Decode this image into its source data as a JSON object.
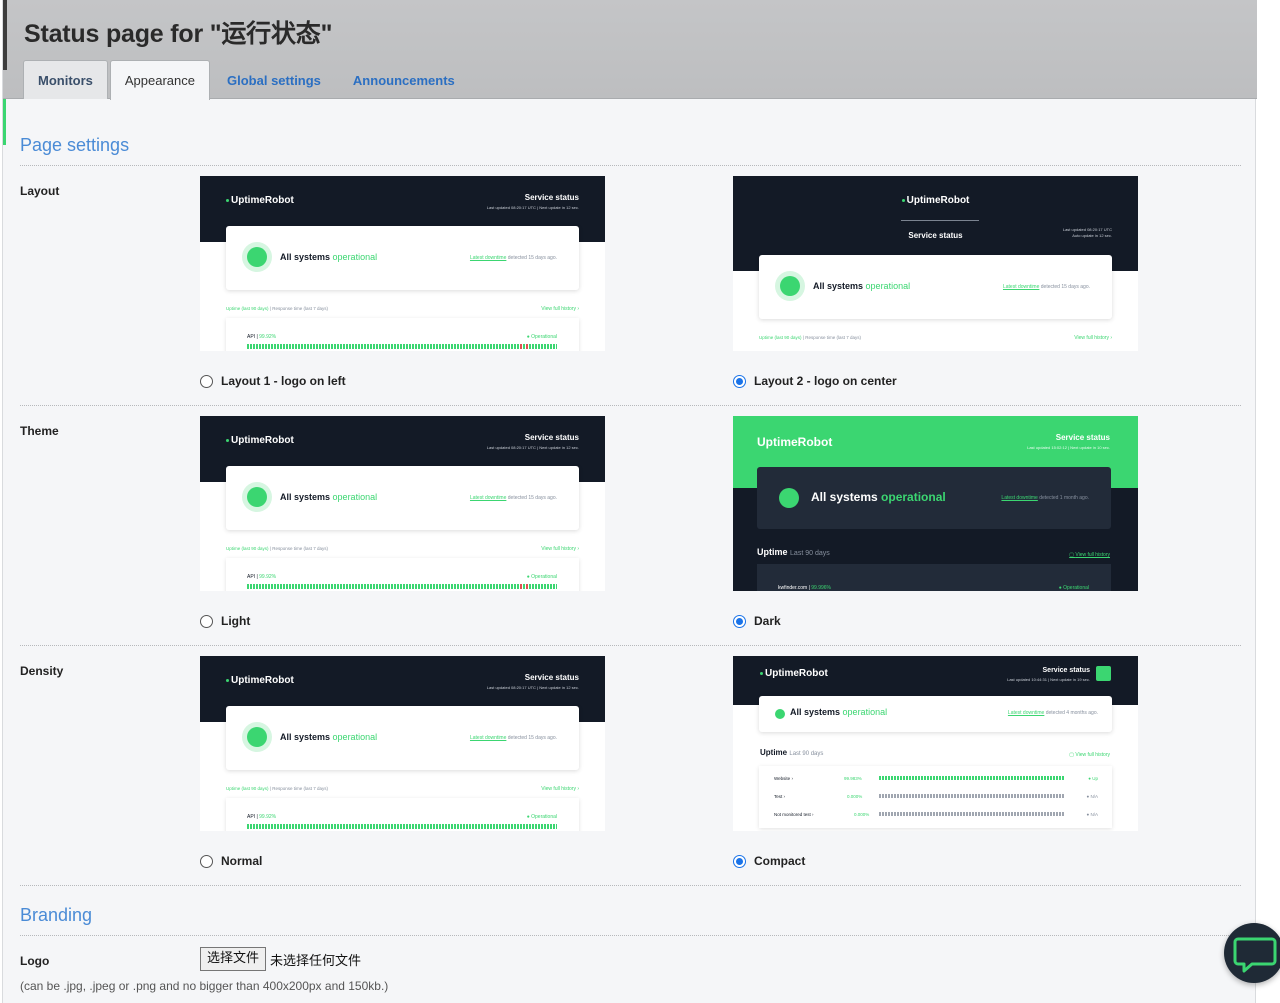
{
  "header": {
    "title": "Status page for \"运行状态\"",
    "tabs": [
      {
        "label": "Monitors"
      },
      {
        "label": "Appearance"
      },
      {
        "label": "Global settings"
      },
      {
        "label": "Announcements"
      }
    ]
  },
  "page_settings": {
    "title": "Page settings",
    "layout": {
      "label": "Layout",
      "options": [
        {
          "label": "Layout 1 - logo on left",
          "selected": false
        },
        {
          "label": "Layout 2 - logo on center",
          "selected": true
        }
      ]
    },
    "theme": {
      "label": "Theme",
      "options": [
        {
          "label": "Light",
          "selected": false
        },
        {
          "label": "Dark",
          "selected": true
        }
      ]
    },
    "density": {
      "label": "Density",
      "options": [
        {
          "label": "Normal",
          "selected": false
        },
        {
          "label": "Compact",
          "selected": true
        }
      ]
    }
  },
  "preview": {
    "brand": "UptimeRobot",
    "service_status": "Service status",
    "last_updated": "Last updated  08:20:17 UTC | Next update in 12 sec.",
    "last_updated_center_1": "Last updated  08:20:17 UTC",
    "last_updated_center_2": "Auto update in 12 sec.",
    "last_updated_dark": "Last updated 15:02:12 | Next update in 10 sec.",
    "last_updated_compact": "Last updated 10:44:31 | Next update in 19 sec.",
    "all_systems": "All systems",
    "operational": "operational",
    "latest_downtime": "Latest downtime",
    "detected_15_days": "detected 15 days ago.",
    "detected_1_month": "detected 1 month ago.",
    "detected_4_months": "detected 4 months ago.",
    "uptime_label": "Uptime",
    "uptime_sub": "(last 90 days)",
    "response_label": "Response time",
    "response_sub": "(last 7 days)",
    "view_full_history": "View full history  ›",
    "view_full_history_plain": "View full history",
    "api_name": "API",
    "api_pct": "99.92%",
    "operational_tag": "Operational",
    "uptime_title": "Uptime",
    "last_90_days": "Last 90 days",
    "dark_monitor": "kwfinder.com",
    "dark_pct": "99.996%",
    "compact_rows": [
      {
        "name": "Website",
        "pct": "99.983%",
        "status": "Up"
      },
      {
        "name": "Test",
        "pct": "0.000%",
        "status": "N/A"
      },
      {
        "name": "Not monitored test",
        "pct": "0.000%",
        "status": "N/A"
      }
    ]
  },
  "branding": {
    "title": "Branding",
    "logo_label": "Logo",
    "file_button": "选择文件",
    "file_none": "未选择任何文件",
    "hint": "(can be .jpg, .jpeg or .png and no bigger than 400x200px and 150kb.)"
  },
  "colors": {
    "accent_green": "#3bd671",
    "dark_navy": "#131a26",
    "link_blue": "#4a8bd6",
    "radio_blue": "#1a73e8"
  },
  "icons": {
    "chat": "chat-bubble-icon"
  }
}
